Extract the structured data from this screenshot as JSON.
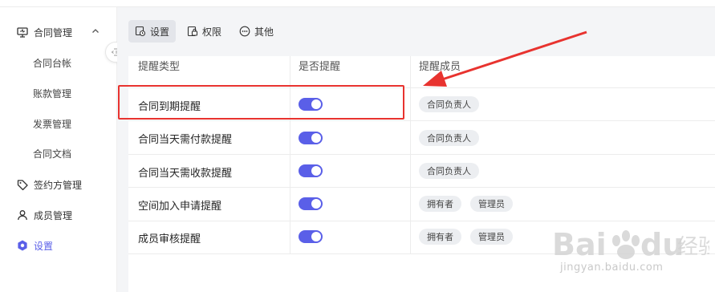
{
  "sidebar": {
    "contract_mgmt": {
      "label": "合同管理"
    },
    "sub_items": [
      {
        "label": "合同台帐"
      },
      {
        "label": "账款管理"
      },
      {
        "label": "发票管理"
      },
      {
        "label": "合同文档"
      }
    ],
    "signatory_mgmt": {
      "label": "签约方管理"
    },
    "member_mgmt": {
      "label": "成员管理"
    },
    "settings": {
      "label": "设置"
    }
  },
  "tabs": [
    {
      "label": "设置"
    },
    {
      "label": "权限"
    },
    {
      "label": "其他"
    }
  ],
  "table": {
    "headers": [
      "提醒类型",
      "是否提醒",
      "提醒成员"
    ],
    "rows": [
      {
        "type": "合同到期提醒",
        "enabled": true,
        "members": [
          "合同负责人"
        ]
      },
      {
        "type": "合同当天需付款提醒",
        "enabled": true,
        "members": [
          "合同负责人"
        ]
      },
      {
        "type": "合同当天需收款提醒",
        "enabled": true,
        "members": [
          "合同负责人"
        ]
      },
      {
        "type": "空间加入申请提醒",
        "enabled": true,
        "members": [
          "拥有者",
          "管理员"
        ]
      },
      {
        "type": "成员审核提醒",
        "enabled": true,
        "members": [
          "拥有者",
          "管理员"
        ]
      }
    ]
  },
  "watermark": {
    "url": "jingyan.baidu.com"
  },
  "colors": {
    "accent": "#5a5fe8",
    "annotation": "#e8332f",
    "chip_bg": "#eceef1"
  }
}
